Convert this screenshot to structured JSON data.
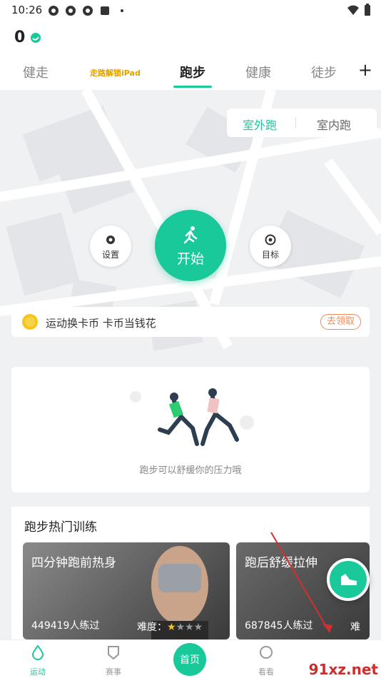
{
  "status_bar": {
    "time": "10:26"
  },
  "coins": {
    "count": "0"
  },
  "tabs": [
    {
      "label": "健走"
    },
    {
      "label": "跑步"
    },
    {
      "label": "健康"
    },
    {
      "label": "徒步"
    }
  ],
  "tab_promo": "走路解锁iPad",
  "mode": {
    "outdoor": "室外跑",
    "indoor": "室内跑"
  },
  "controls": {
    "settings": "设置",
    "start": "开始",
    "goal": "目标"
  },
  "coin_banner": {
    "text": "运动换卡币 卡币当钱花",
    "claim": "去领取"
  },
  "illustration": {
    "caption": "跑步可以舒缓你的压力哦"
  },
  "training": {
    "title": "跑步热门训练",
    "cards": [
      {
        "name": "四分钟跑前热身",
        "count": "449419人练过",
        "difficulty": "难度：",
        "stars": 1
      },
      {
        "name": "跑后舒缓拉伸",
        "count": "687845人练过",
        "difficulty": "难"
      }
    ]
  },
  "bottom_nav": {
    "sport": "运动",
    "events": "赛事",
    "home": "首页",
    "watch": "看看"
  },
  "watermark": "91xz.net",
  "colors": {
    "accent": "#1ac99a",
    "promo": "#e0a000",
    "claim": "#f08a5d"
  }
}
